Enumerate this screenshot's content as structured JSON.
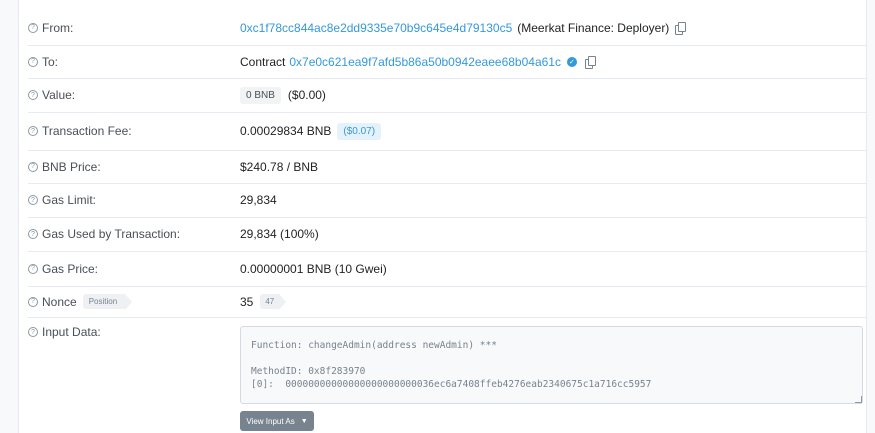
{
  "from": {
    "label": "From:",
    "address": "0xc1f78cc844ac8e2dd9335e70b9c645e4d79130c5",
    "name": "(Meerkat Finance: Deployer)"
  },
  "to": {
    "label": "To:",
    "prefix": "Contract",
    "address": "0x7e0c621ea9f7afd5b86a50b0942eaee68b04a61c"
  },
  "value": {
    "label": "Value:",
    "amount": "0 BNB",
    "usd": "($0.00)"
  },
  "fee": {
    "label": "Transaction Fee:",
    "amount": "0.00029834 BNB",
    "usd": "($0.07)"
  },
  "price": {
    "label": "BNB Price:",
    "value": "$240.78 / BNB"
  },
  "gas_limit": {
    "label": "Gas Limit:",
    "value": "29,834"
  },
  "gas_used": {
    "label": "Gas Used by Transaction:",
    "value": "29,834 (100%)"
  },
  "gas_price": {
    "label": "Gas Price:",
    "value": "0.00000001 BNB (10 Gwei)"
  },
  "nonce": {
    "label": "Nonce",
    "tag": "Position",
    "value": "35",
    "position": "47"
  },
  "input": {
    "label": "Input Data:",
    "text": "Function: changeAdmin(address newAdmin) ***\n\nMethodID: 0x8f283970\n[0]:  00000000000000000000000036ec6a7408ffeb4276eab2340675c1a716cc5957",
    "button": "View Input As"
  },
  "icons": {
    "help": "question-circle-icon",
    "copy": "copy-icon",
    "verified": "verified-check-icon",
    "caret": "chevron-down-icon"
  }
}
